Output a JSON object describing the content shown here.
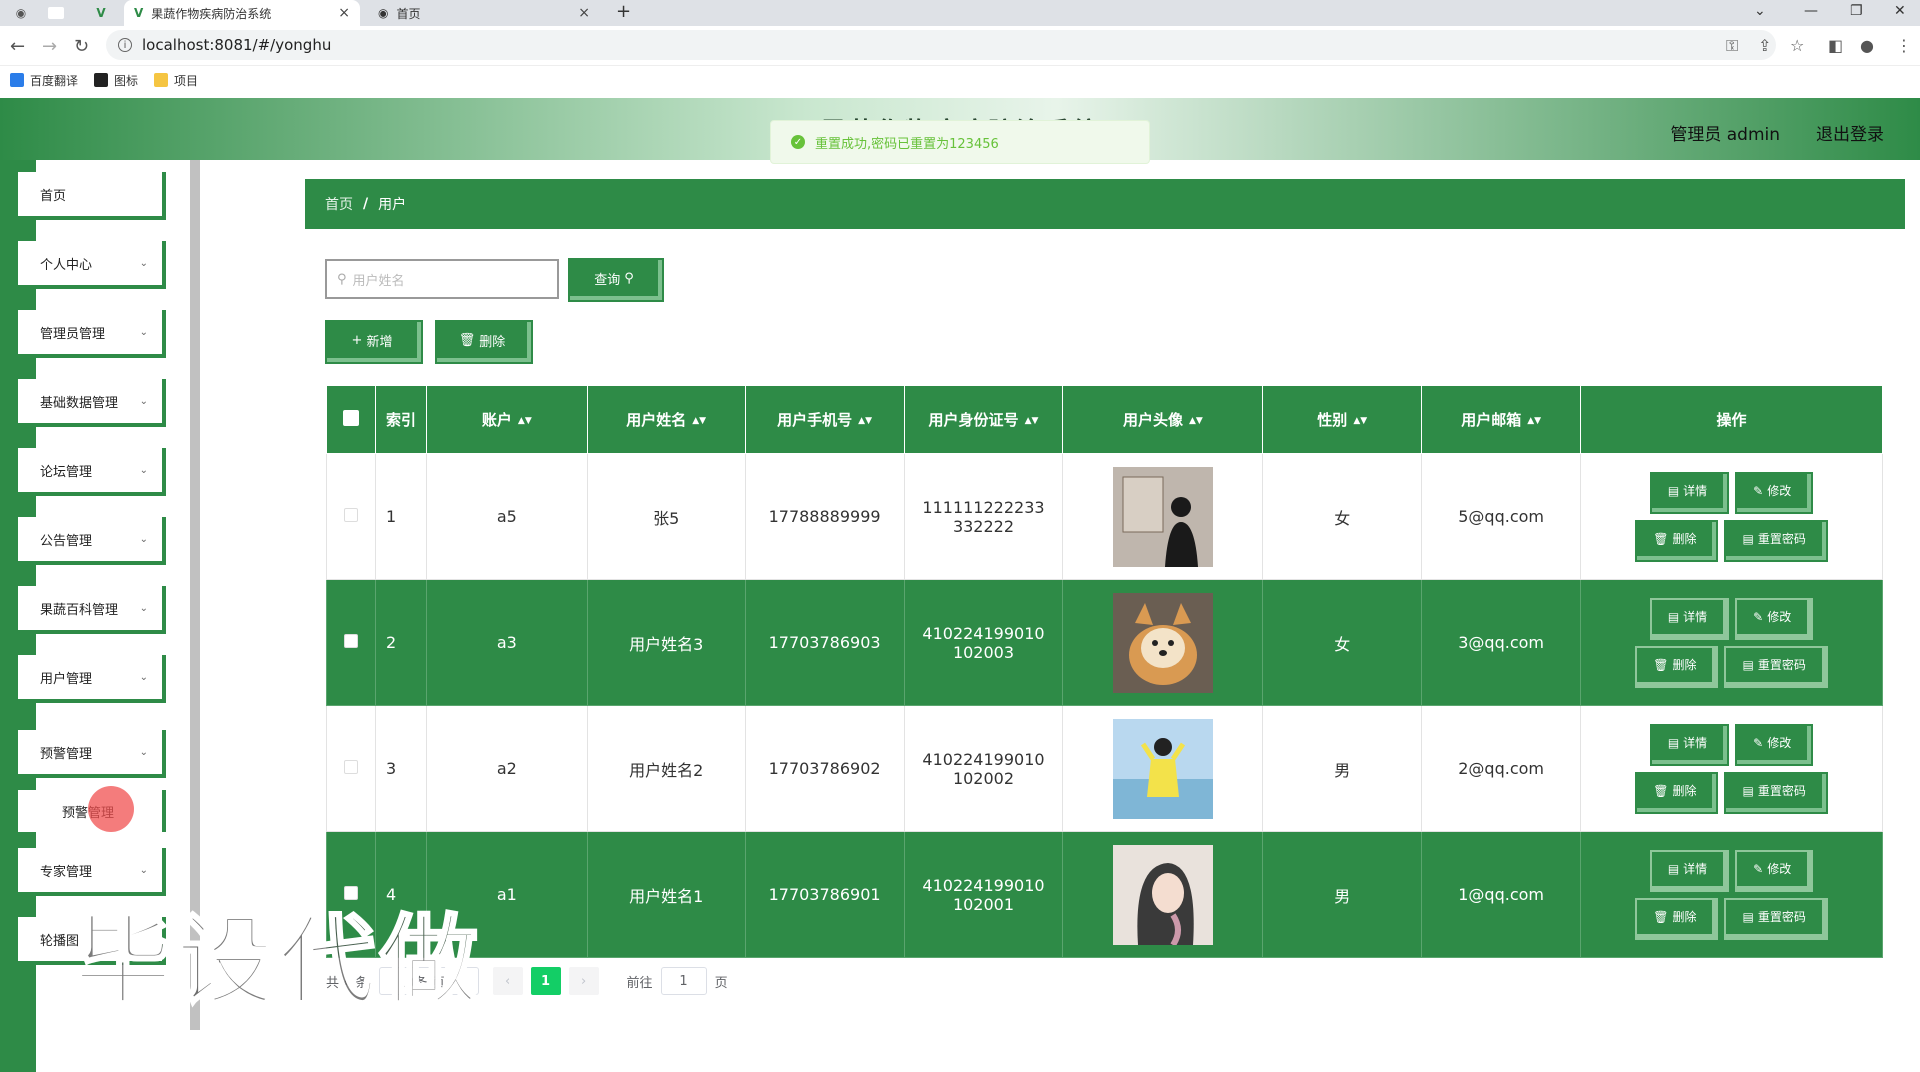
{
  "browser": {
    "tabs": [
      {
        "label": "果蔬作物疾病防治系统",
        "close": "×"
      },
      {
        "label": "首页",
        "close": "×"
      }
    ],
    "new_tab": "+",
    "url": "localhost:8081/#/yonghu",
    "bookmarks": [
      "百度翻译",
      "图标",
      "项目"
    ]
  },
  "header": {
    "title": "果蔬作物疾病防治系统",
    "user": "管理员 admin",
    "logout": "退出登录"
  },
  "toast": {
    "message": "重置成功,密码已重置为123456"
  },
  "sidebar": {
    "items": [
      {
        "label": "首页",
        "has_children": false
      },
      {
        "label": "个人中心",
        "has_children": true
      },
      {
        "label": "管理员管理",
        "has_children": true
      },
      {
        "label": "基础数据管理",
        "has_children": true
      },
      {
        "label": "论坛管理",
        "has_children": true
      },
      {
        "label": "公告管理",
        "has_children": true
      },
      {
        "label": "果蔬百科管理",
        "has_children": true
      },
      {
        "label": "用户管理",
        "has_children": true
      },
      {
        "label": "预警管理",
        "has_children": true
      },
      {
        "label": "专家管理",
        "has_children": true
      },
      {
        "label": "轮播图"
      }
    ],
    "submenu": {
      "label": "预警管理"
    }
  },
  "watermark": "毕设代做",
  "breadcrumb": {
    "home": "首页",
    "separator": "/",
    "current": "用户"
  },
  "search": {
    "placeholder": "用户姓名",
    "button": "查询"
  },
  "actions": {
    "add": "新增",
    "delete": "删除"
  },
  "table": {
    "columns": [
      "索引",
      "账户",
      "用户姓名",
      "用户手机号",
      "用户身份证号",
      "用户头像",
      "性别",
      "用户邮箱",
      "操作"
    ],
    "rows": [
      {
        "index": "1",
        "account": "a5",
        "name": "张5",
        "phone": "17788889999",
        "id_card": "111111222233332222",
        "gender": "女",
        "email": "5@qq.com"
      },
      {
        "index": "2",
        "account": "a3",
        "name": "用户姓名3",
        "phone": "17703786903",
        "id_card": "410224199010102003",
        "gender": "女",
        "email": "3@qq.com"
      },
      {
        "index": "3",
        "account": "a2",
        "name": "用户姓名2",
        "phone": "17703786902",
        "id_card": "410224199010102002",
        "gender": "男",
        "email": "2@qq.com"
      },
      {
        "index": "4",
        "account": "a1",
        "name": "用户姓名1",
        "phone": "17703786901",
        "id_card": "410224199010102001",
        "gender": "男",
        "email": "1@qq.com"
      }
    ],
    "row_ops": {
      "detail": "详情",
      "edit": "修改",
      "delete": "删除",
      "reset": "重置密码"
    }
  },
  "pager": {
    "total_prefix": "共 4 条",
    "page_size": "10条/页",
    "current_page": "1",
    "goto_label": "前往",
    "goto_value": "1",
    "goto_suffix": "页"
  },
  "colors": {
    "primary": "#2e8b47",
    "accent_light": "#7cc08e",
    "success": "#67c23a",
    "pager_active": "#13ce66"
  }
}
